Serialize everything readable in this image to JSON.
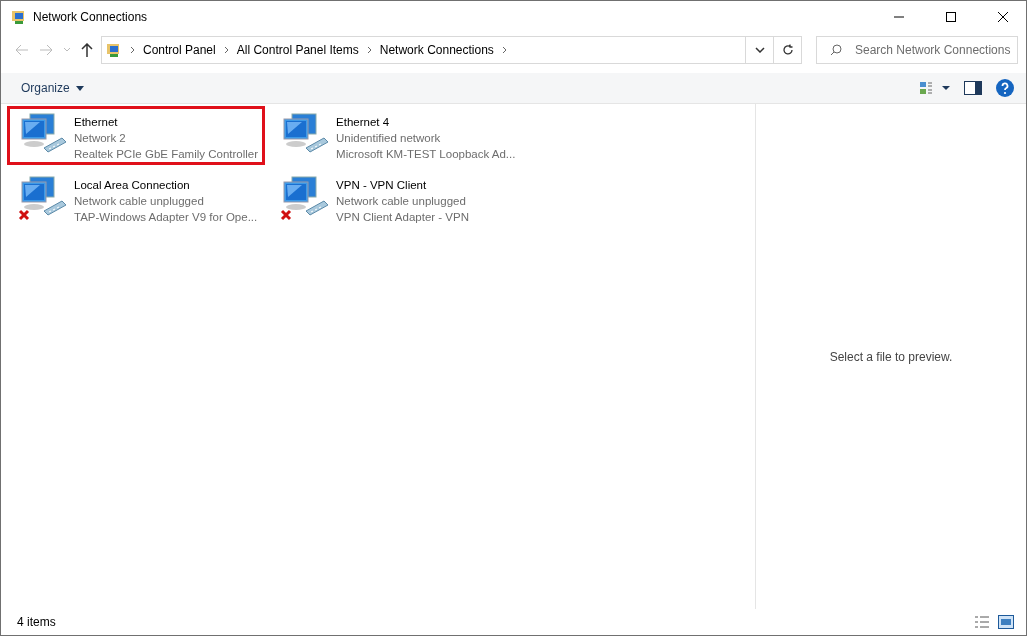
{
  "window": {
    "title": "Network Connections"
  },
  "address_bar": {
    "breadcrumbs": [
      "Control Panel",
      "All Control Panel Items",
      "Network Connections"
    ]
  },
  "search": {
    "placeholder": "Search Network Connections"
  },
  "toolbar": {
    "organize": "Organize"
  },
  "connections": [
    {
      "name": "Ethernet",
      "status": "Network 2",
      "adapter": "Realtek PCIe GbE Family Controller",
      "disconnected": false,
      "highlighted": true
    },
    {
      "name": "Ethernet 4",
      "status": "Unidentified network",
      "adapter": "Microsoft KM-TEST Loopback Ad...",
      "disconnected": false,
      "highlighted": false
    },
    {
      "name": "Local Area Connection",
      "status": "Network cable unplugged",
      "adapter": "TAP-Windows Adapter V9 for Ope...",
      "disconnected": true,
      "highlighted": false
    },
    {
      "name": "VPN - VPN Client",
      "status": "Network cable unplugged",
      "adapter": "VPN Client Adapter - VPN",
      "disconnected": true,
      "highlighted": false
    }
  ],
  "preview": {
    "message": "Select a file to preview."
  },
  "status_bar": {
    "count": "4 items"
  }
}
